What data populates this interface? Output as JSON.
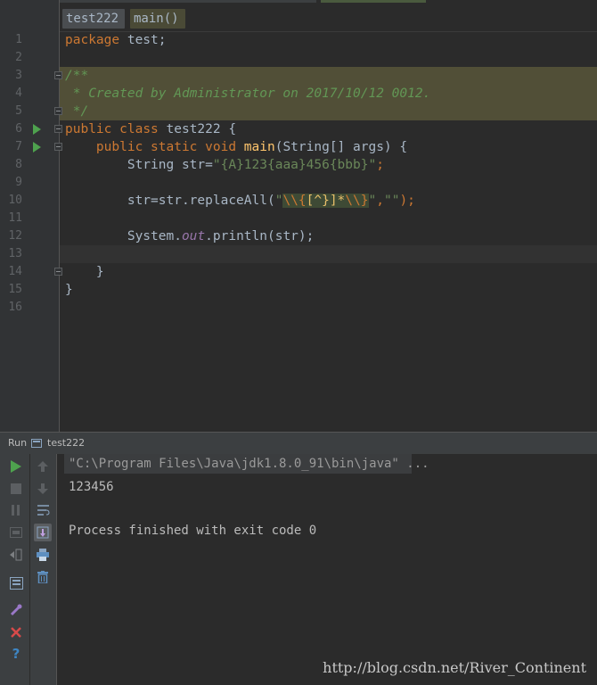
{
  "breadcrumb": {
    "class_name": "test222",
    "method_name": "main()"
  },
  "editor": {
    "line_numbers": [
      "1",
      "2",
      "3",
      "4",
      "5",
      "6",
      "7",
      "8",
      "9",
      "10",
      "11",
      "12",
      "13",
      "14",
      "15",
      "16"
    ],
    "tokens": {
      "l1_kw": "package",
      "l1_rest": " test;",
      "l3": "/**",
      "l4": " * Created by Administrator on 2017/10/12 0012.",
      "l5": " */",
      "l6_kw1": "public",
      "l6_kw2": "class",
      "l6_rest": " test222 {",
      "l7_indent": "    ",
      "l7_kw": "public static void",
      "l7_fn": "main",
      "l7_rest": "(String[] args) {",
      "l8_pre": "        String str=",
      "l8_str": "\"{A}123{aaa}456{bbb}\"",
      "l8_end": ";",
      "l10_pre": "        str=str.replaceAll(",
      "l10_q1": "\"",
      "l10_e1": "\\\\{",
      "l10_r1": "[^}]*",
      "l10_e2": "\\\\}",
      "l10_q2": "\"",
      "l10_comma": ",",
      "l10_str2": "\"\"",
      "l10_end": ");",
      "l12_pre": "        System.",
      "l12_fld": "out",
      "l12_rest": ".println(str);",
      "l14": "    }",
      "l15": "}"
    }
  },
  "run_panel": {
    "title": "Run",
    "config_name": "test222",
    "console": [
      "\"C:\\Program Files\\Java\\jdk1.8.0_91\\bin\\java\" ...",
      "123456",
      "",
      "Process finished with exit code 0"
    ],
    "toolbar1_icons": [
      "run-icon",
      "stop-icon",
      "pause-icon",
      "dump-threads-icon",
      "exit-icon",
      "layout-icon",
      "pin-icon",
      "close-icon",
      "help-icon"
    ],
    "toolbar2_icons": [
      "up-arrow-icon",
      "down-arrow-icon",
      "soft-wrap-icon",
      "scroll-to-end-icon",
      "print-icon",
      "trash-icon"
    ]
  },
  "watermark": "http://blog.csdn.net/River_Continent",
  "colors": {
    "keyword": "#cc7832",
    "comment": "#629755",
    "string": "#6a8759",
    "function": "#ffc66d",
    "field": "#9876aa",
    "run_green": "#4ea24e",
    "error_red": "#d84a4a",
    "help_blue": "#3e86c4"
  }
}
